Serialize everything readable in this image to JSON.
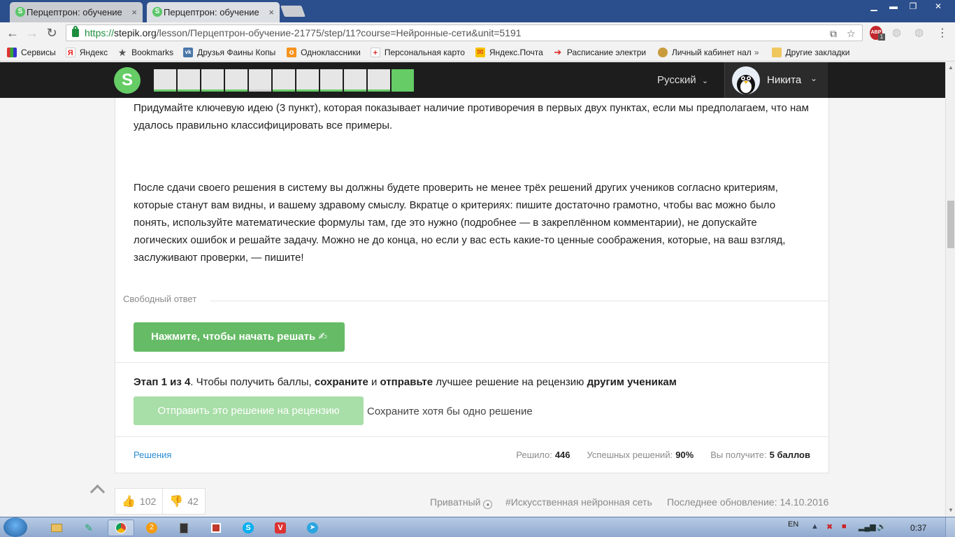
{
  "browser": {
    "tabs": [
      {
        "title": "Перцептрон: обучение",
        "active": false
      },
      {
        "title": "Перцептрон: обучение",
        "active": true
      }
    ],
    "url_secure": "https://",
    "url_host": "stepik.org",
    "url_path": "/lesson/Перцептрон-обучение-21775/step/11?course=Нейронные-сети&unit=5191",
    "bookmarks": [
      {
        "label": "Сервисы",
        "icon": "apps-icon"
      },
      {
        "label": "Яндекс",
        "icon": "yandex-icon"
      },
      {
        "label": "Bookmarks",
        "icon": "star-icon"
      },
      {
        "label": "Друзья Фаины Копы",
        "icon": "vk-icon"
      },
      {
        "label": "Одноклассники",
        "icon": "ok-icon"
      },
      {
        "label": "Персональная карто",
        "icon": "medical-icon"
      },
      {
        "label": "Яндекс.Почта",
        "icon": "mail-icon"
      },
      {
        "label": "Расписание электри",
        "icon": "train-icon"
      },
      {
        "label": "Личный кабинет нал",
        "icon": "tax-icon"
      }
    ],
    "bookmarks_more": "»",
    "other_bookmarks": "Другие закладки",
    "abp_badge": "1"
  },
  "header": {
    "logo": "S",
    "language": "Русский",
    "user": "Никита",
    "steps": [
      "passed",
      "passed",
      "passed",
      "passed",
      "todo",
      "passed",
      "passed",
      "passed",
      "passed",
      "passed",
      "current"
    ]
  },
  "content": {
    "para1": "Придумайте ключевую идею (3 пункт), которая показывает наличие противоречия в первых двух пунктах, если мы предполагаем, что нам удалось правильно классифицировать все примеры.",
    "para2": "После сдачи своего решения в систему вы должны будете проверить не менее трёх решений других учеников согласно критериям, которые станут вам видны, и вашему здравому смыслу. Вкратце о критериях: пишите достаточно грамотно, чтобы вас можно было понять, используйте математические формулы там, где это нужно (подробнее — в закреплённом комментарии), не допускайте логических ошибок и решайте задачу. Можно не до конца, но если у вас есть какие-то ценные соображения, которые, на ваш взгляд, заслуживают проверки, — пишите!",
    "free_answer_label": "Свободный ответ",
    "solve_button": "Нажмите, чтобы начать решать ✍",
    "stage": {
      "prefix": "Этап 1 из 4",
      "t1": ". Чтобы получить баллы, ",
      "b1": "сохраните",
      "t2": " и ",
      "b2": "отправьте",
      "t3": " лучшее решение на рецензию ",
      "b3": "другим ученикам"
    },
    "review_button": "Отправить это решение на рецензию",
    "save_hint": "Сохраните хотя бы одно решение",
    "solutions_link": "Решения",
    "stats": {
      "solved_label": "Решило:",
      "solved_value": "446",
      "success_label": "Успешных решений:",
      "success_value": "90%",
      "reward_label": "Вы получите:",
      "reward_value": "5 баллов"
    }
  },
  "footer": {
    "likes": "102",
    "dislikes": "42",
    "private": "Приватный",
    "tag": "#Искусственная нейронная сеть",
    "updated": "Последнее обновление: 14.10.2016"
  },
  "taskbar": {
    "lang": "EN",
    "time": "0:37"
  }
}
